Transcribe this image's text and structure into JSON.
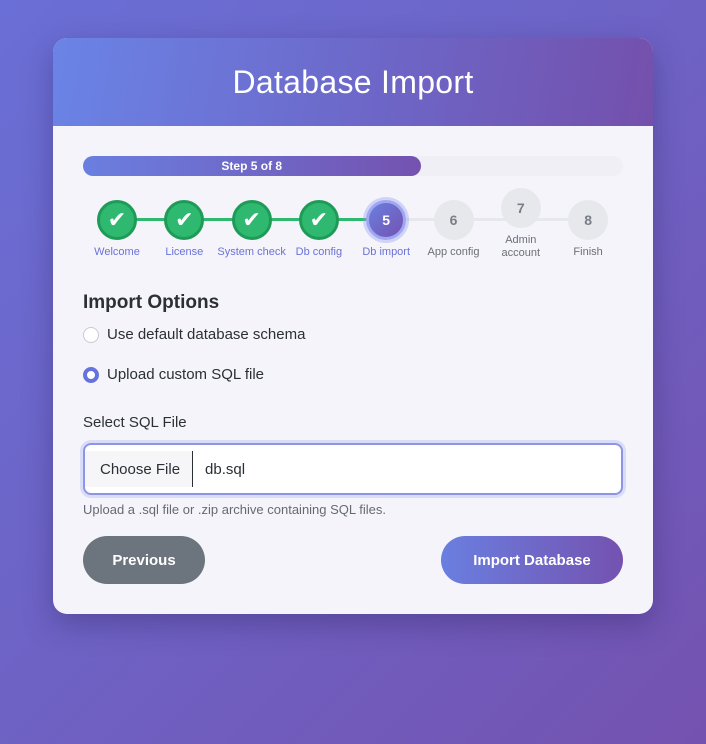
{
  "header": {
    "title": "Database Import"
  },
  "progress": {
    "label": "Step 5 of 8",
    "current_step": 5,
    "total_steps": 8,
    "fraction": 0.625
  },
  "steps": [
    {
      "number": "",
      "label": "Welcome",
      "state": "done"
    },
    {
      "number": "",
      "label": "License",
      "state": "done"
    },
    {
      "number": "",
      "label": "System check",
      "state": "done"
    },
    {
      "number": "",
      "label": "Db config",
      "state": "done"
    },
    {
      "number": "5",
      "label": "Db import",
      "state": "active"
    },
    {
      "number": "6",
      "label": "App config",
      "state": "pending"
    },
    {
      "number": "7",
      "label": "Admin account",
      "state": "pending"
    },
    {
      "number": "8",
      "label": "Finish",
      "state": "pending"
    }
  ],
  "import_options": {
    "title": "Import Options",
    "options": [
      {
        "label": "Use default database schema",
        "checked": false
      },
      {
        "label": "Upload custom SQL file",
        "checked": true
      }
    ]
  },
  "file_field": {
    "label": "Select SQL File",
    "button_label": "Choose File",
    "file_name": "db.sql",
    "help": "Upload a .sql file or .zip archive containing SQL files."
  },
  "buttons": {
    "previous": "Previous",
    "import": "Import Database"
  },
  "colors": {
    "accent": "#6a7fe0",
    "accent_end": "#7452b0",
    "done_green": "#2fb870",
    "secondary": "#6c757d"
  },
  "icons": {
    "done": "check-icon"
  }
}
